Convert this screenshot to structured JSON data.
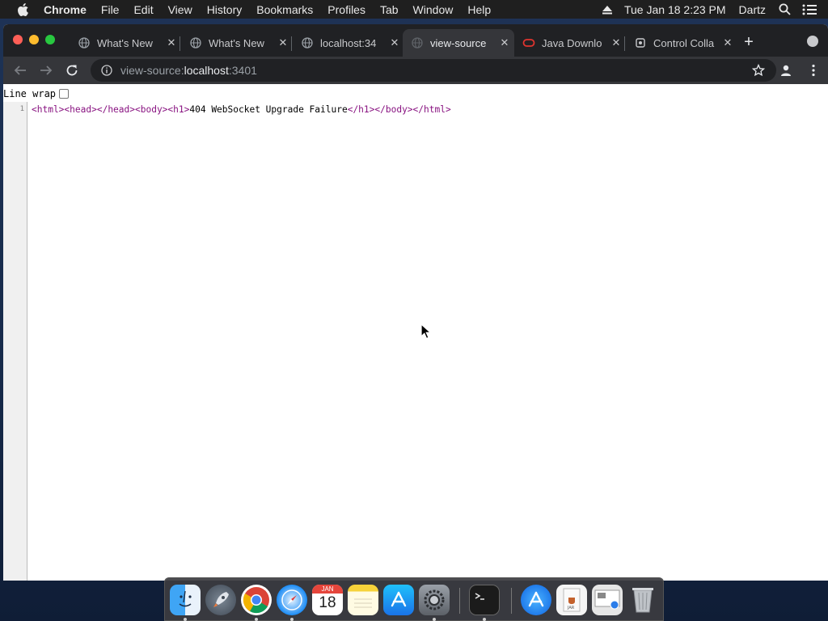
{
  "menubar": {
    "app_name": "Chrome",
    "menus": [
      "File",
      "Edit",
      "View",
      "History",
      "Bookmarks",
      "Profiles",
      "Tab",
      "Window",
      "Help"
    ],
    "datetime": "Tue Jan 18  2:23 PM",
    "user": "Dartz"
  },
  "tabs": [
    {
      "title": "What's New",
      "icon": "globe-icon"
    },
    {
      "title": "What's New",
      "icon": "globe-icon"
    },
    {
      "title": "localhost:34",
      "icon": "globe-icon"
    },
    {
      "title": "view-source",
      "icon": "globe-icon",
      "active": true
    },
    {
      "title": "Java Downlo",
      "icon": "oracle-icon"
    },
    {
      "title": "Control Colla",
      "icon": "control-icon"
    }
  ],
  "address_bar": {
    "scheme": "view-source:",
    "host": "localhost",
    "port": ":3401"
  },
  "page": {
    "line_wrap_label": "Line wrap",
    "line_wrap_checked": false,
    "line_number": "1",
    "source": {
      "open_html": "<html>",
      "open_head": "<head>",
      "close_head": "</head>",
      "open_body": "<body>",
      "open_h1": "<h1>",
      "text": "404 WebSocket Upgrade Failure",
      "close_h1": "</h1>",
      "close_body": "</body>",
      "close_html": "</html>"
    }
  },
  "dock": {
    "calendar_month": "JAN",
    "calendar_day": "18",
    "apps": [
      "finder",
      "launchpad",
      "chrome",
      "safari",
      "calendar",
      "notes",
      "app-store",
      "system-preferences",
      "terminal",
      "app-store",
      "java-jar",
      "preview",
      "trash"
    ]
  },
  "colors": {
    "tag_purple": "#881280",
    "chrome_dark": "#202124",
    "toolbar_dark": "#35363a"
  }
}
